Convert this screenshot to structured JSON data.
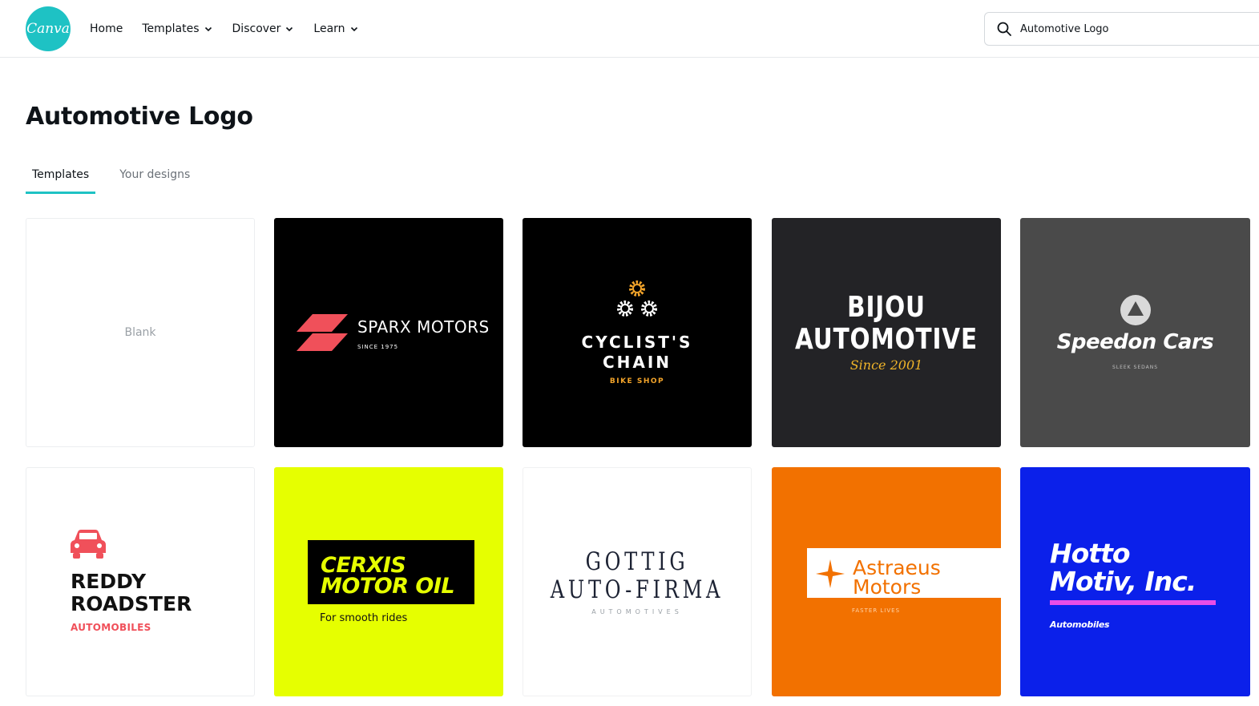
{
  "header": {
    "logo_text": "Canva",
    "nav": [
      {
        "label": "Home"
      },
      {
        "label": "Templates"
      },
      {
        "label": "Discover"
      },
      {
        "label": "Learn"
      }
    ],
    "search": {
      "value": "Automotive Logo"
    }
  },
  "page": {
    "title": "Automotive Logo",
    "tabs": [
      {
        "label": "Templates",
        "active": true
      },
      {
        "label": "Your designs",
        "active": false
      }
    ]
  },
  "templates": [
    {
      "label": "Blank"
    },
    {
      "title": "SPARX MOTORS",
      "subtitle": "SINCE 1975"
    },
    {
      "title_line1": "CYCLIST'S",
      "title_line2": "CHAIN",
      "subtitle": "BIKE SHOP"
    },
    {
      "title_line1": "BIJOU",
      "title_line2": "AUTOMOTIVE",
      "subtitle": "Since 2001"
    },
    {
      "title": "Speedon Cars",
      "subtitle": "SLEEK SEDANS"
    },
    {
      "title_line1": "REDDY",
      "title_line2": "ROADSTER",
      "subtitle": "AUTOMOBILES"
    },
    {
      "title_line1": "CERXIS",
      "title_line2": "MOTOR OIL",
      "subtitle": "For smooth rides"
    },
    {
      "title_line1": "GOTTIG",
      "title_line2": "AUTO-FIRMA",
      "subtitle": "AUTOMOTIVES"
    },
    {
      "title_line1": "Astraeus",
      "title_line2": "Motors",
      "subtitle": "FASTER LIVES"
    },
    {
      "title_line1": "Hotto",
      "title_line2": "Motiv, Inc.",
      "subtitle": "Automobiles"
    }
  ],
  "colors": {
    "brand_teal": "#1ec2c4",
    "sparx_red": "#f0505a",
    "cyclist_gold": "#f3a42a",
    "bijou_gold": "#f0b429",
    "reddy_red": "#f0505a",
    "cerxis_yellow": "#e6ff00",
    "astraeus_orange": "#f27100",
    "hotto_blue": "#0b20ea",
    "hotto_pink": "#e94de8"
  }
}
